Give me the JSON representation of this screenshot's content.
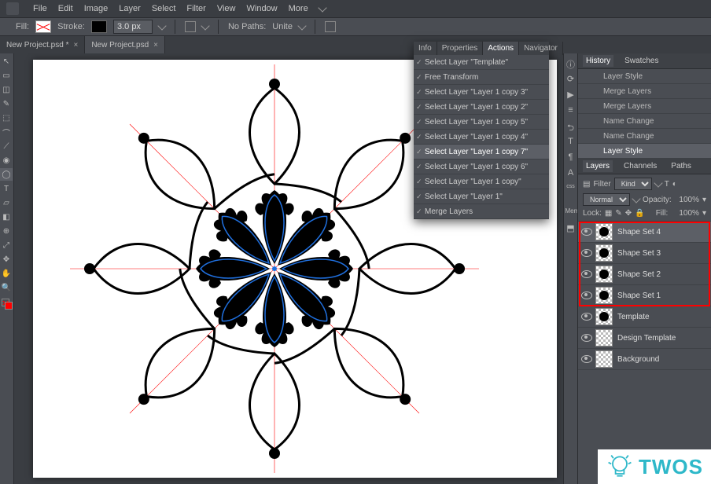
{
  "menubar": [
    "File",
    "Edit",
    "Image",
    "Layer",
    "Select",
    "Filter",
    "View",
    "Window",
    "More"
  ],
  "optionsbar": {
    "fill_label": "Fill:",
    "stroke_label": "Stroke:",
    "stroke_width": "3.0 px",
    "nopaths_label": "No Paths:",
    "unite_label": "Unite"
  },
  "tabs": [
    {
      "label": "New Project.psd *",
      "active": false
    },
    {
      "label": "New Project.psd",
      "active": true
    }
  ],
  "toolbar_tools": [
    "↖",
    "▭",
    "◫",
    "✎",
    "⬚",
    "⌒",
    "⟋",
    "◉",
    "◯",
    "T",
    "▱",
    "◧",
    "⊕",
    "⤢",
    "✥",
    "✋",
    "🔍"
  ],
  "info_panel": {
    "tabs": [
      "Info",
      "Properties",
      "Actions",
      "Navigator"
    ],
    "active_tab": "Actions",
    "actions": [
      {
        "label": "Select Layer \"Template\"",
        "sel": false
      },
      {
        "label": "Free Transform",
        "sel": false
      },
      {
        "label": "Select Layer \"Layer 1 copy 3\"",
        "sel": false
      },
      {
        "label": "Select Layer \"Layer 1 copy 2\"",
        "sel": false
      },
      {
        "label": "Select Layer \"Layer 1 copy 5\"",
        "sel": false
      },
      {
        "label": "Select Layer \"Layer 1 copy 4\"",
        "sel": false
      },
      {
        "label": "Select Layer \"Layer 1 copy 7\"",
        "sel": true
      },
      {
        "label": "Select Layer \"Layer 1 copy 6\"",
        "sel": false
      },
      {
        "label": "Select Layer \"Layer 1 copy\"",
        "sel": false
      },
      {
        "label": "Select Layer \"Layer 1\"",
        "sel": false
      },
      {
        "label": "Merge Layers",
        "sel": false
      }
    ]
  },
  "right_panels": {
    "history": {
      "tabs": [
        "History",
        "Swatches"
      ],
      "active": "History",
      "items": [
        {
          "label": "Layer Style"
        },
        {
          "label": "Merge Layers"
        },
        {
          "label": "Merge Layers"
        },
        {
          "label": "Name Change"
        },
        {
          "label": "Name Change"
        },
        {
          "label": "Layer Style",
          "sel": true
        }
      ]
    },
    "layers": {
      "tabs": [
        "Layers",
        "Channels",
        "Paths"
      ],
      "active": "Layers",
      "filter_label": "Filter",
      "kind_label": "Kind",
      "blend_mode": "Normal",
      "opacity_label": "Opacity:",
      "opacity_val": "100%",
      "lock_label": "Lock:",
      "fill_label": "Fill:",
      "fill_val": "100%",
      "layers_list": [
        {
          "name": "Shape Set 4",
          "visible": true,
          "sel": true,
          "hl": true
        },
        {
          "name": "Shape Set 3",
          "visible": true,
          "hl": true
        },
        {
          "name": "Shape Set 2",
          "visible": true,
          "hl": true
        },
        {
          "name": "Shape Set 1",
          "visible": true,
          "hl": true
        },
        {
          "name": "Template",
          "visible": true
        },
        {
          "name": "Design Template",
          "visible": true
        },
        {
          "name": "Background",
          "visible": true
        }
      ]
    }
  },
  "right_strip_icons": [
    "ⓘ",
    "⟳",
    "▶",
    "≡",
    "⮌",
    "T",
    "¶",
    "A",
    "css",
    "⬒"
  ],
  "right_strip_label": "Mem",
  "badge_text": "TWOS"
}
